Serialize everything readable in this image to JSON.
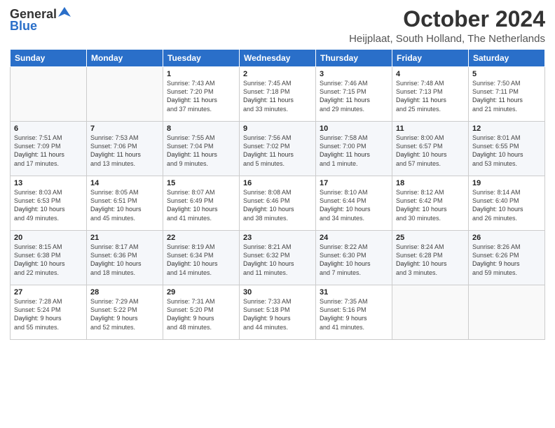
{
  "logo": {
    "general": "General",
    "blue": "Blue"
  },
  "title": "October 2024",
  "location": "Heijplaat, South Holland, The Netherlands",
  "days_of_week": [
    "Sunday",
    "Monday",
    "Tuesday",
    "Wednesday",
    "Thursday",
    "Friday",
    "Saturday"
  ],
  "weeks": [
    [
      {
        "day": "",
        "content": ""
      },
      {
        "day": "",
        "content": ""
      },
      {
        "day": "1",
        "content": "Sunrise: 7:43 AM\nSunset: 7:20 PM\nDaylight: 11 hours\nand 37 minutes."
      },
      {
        "day": "2",
        "content": "Sunrise: 7:45 AM\nSunset: 7:18 PM\nDaylight: 11 hours\nand 33 minutes."
      },
      {
        "day": "3",
        "content": "Sunrise: 7:46 AM\nSunset: 7:15 PM\nDaylight: 11 hours\nand 29 minutes."
      },
      {
        "day": "4",
        "content": "Sunrise: 7:48 AM\nSunset: 7:13 PM\nDaylight: 11 hours\nand 25 minutes."
      },
      {
        "day": "5",
        "content": "Sunrise: 7:50 AM\nSunset: 7:11 PM\nDaylight: 11 hours\nand 21 minutes."
      }
    ],
    [
      {
        "day": "6",
        "content": "Sunrise: 7:51 AM\nSunset: 7:09 PM\nDaylight: 11 hours\nand 17 minutes."
      },
      {
        "day": "7",
        "content": "Sunrise: 7:53 AM\nSunset: 7:06 PM\nDaylight: 11 hours\nand 13 minutes."
      },
      {
        "day": "8",
        "content": "Sunrise: 7:55 AM\nSunset: 7:04 PM\nDaylight: 11 hours\nand 9 minutes."
      },
      {
        "day": "9",
        "content": "Sunrise: 7:56 AM\nSunset: 7:02 PM\nDaylight: 11 hours\nand 5 minutes."
      },
      {
        "day": "10",
        "content": "Sunrise: 7:58 AM\nSunset: 7:00 PM\nDaylight: 11 hours\nand 1 minute."
      },
      {
        "day": "11",
        "content": "Sunrise: 8:00 AM\nSunset: 6:57 PM\nDaylight: 10 hours\nand 57 minutes."
      },
      {
        "day": "12",
        "content": "Sunrise: 8:01 AM\nSunset: 6:55 PM\nDaylight: 10 hours\nand 53 minutes."
      }
    ],
    [
      {
        "day": "13",
        "content": "Sunrise: 8:03 AM\nSunset: 6:53 PM\nDaylight: 10 hours\nand 49 minutes."
      },
      {
        "day": "14",
        "content": "Sunrise: 8:05 AM\nSunset: 6:51 PM\nDaylight: 10 hours\nand 45 minutes."
      },
      {
        "day": "15",
        "content": "Sunrise: 8:07 AM\nSunset: 6:49 PM\nDaylight: 10 hours\nand 41 minutes."
      },
      {
        "day": "16",
        "content": "Sunrise: 8:08 AM\nSunset: 6:46 PM\nDaylight: 10 hours\nand 38 minutes."
      },
      {
        "day": "17",
        "content": "Sunrise: 8:10 AM\nSunset: 6:44 PM\nDaylight: 10 hours\nand 34 minutes."
      },
      {
        "day": "18",
        "content": "Sunrise: 8:12 AM\nSunset: 6:42 PM\nDaylight: 10 hours\nand 30 minutes."
      },
      {
        "day": "19",
        "content": "Sunrise: 8:14 AM\nSunset: 6:40 PM\nDaylight: 10 hours\nand 26 minutes."
      }
    ],
    [
      {
        "day": "20",
        "content": "Sunrise: 8:15 AM\nSunset: 6:38 PM\nDaylight: 10 hours\nand 22 minutes."
      },
      {
        "day": "21",
        "content": "Sunrise: 8:17 AM\nSunset: 6:36 PM\nDaylight: 10 hours\nand 18 minutes."
      },
      {
        "day": "22",
        "content": "Sunrise: 8:19 AM\nSunset: 6:34 PM\nDaylight: 10 hours\nand 14 minutes."
      },
      {
        "day": "23",
        "content": "Sunrise: 8:21 AM\nSunset: 6:32 PM\nDaylight: 10 hours\nand 11 minutes."
      },
      {
        "day": "24",
        "content": "Sunrise: 8:22 AM\nSunset: 6:30 PM\nDaylight: 10 hours\nand 7 minutes."
      },
      {
        "day": "25",
        "content": "Sunrise: 8:24 AM\nSunset: 6:28 PM\nDaylight: 10 hours\nand 3 minutes."
      },
      {
        "day": "26",
        "content": "Sunrise: 8:26 AM\nSunset: 6:26 PM\nDaylight: 9 hours\nand 59 minutes."
      }
    ],
    [
      {
        "day": "27",
        "content": "Sunrise: 7:28 AM\nSunset: 5:24 PM\nDaylight: 9 hours\nand 55 minutes."
      },
      {
        "day": "28",
        "content": "Sunrise: 7:29 AM\nSunset: 5:22 PM\nDaylight: 9 hours\nand 52 minutes."
      },
      {
        "day": "29",
        "content": "Sunrise: 7:31 AM\nSunset: 5:20 PM\nDaylight: 9 hours\nand 48 minutes."
      },
      {
        "day": "30",
        "content": "Sunrise: 7:33 AM\nSunset: 5:18 PM\nDaylight: 9 hours\nand 44 minutes."
      },
      {
        "day": "31",
        "content": "Sunrise: 7:35 AM\nSunset: 5:16 PM\nDaylight: 9 hours\nand 41 minutes."
      },
      {
        "day": "",
        "content": ""
      },
      {
        "day": "",
        "content": ""
      }
    ]
  ]
}
